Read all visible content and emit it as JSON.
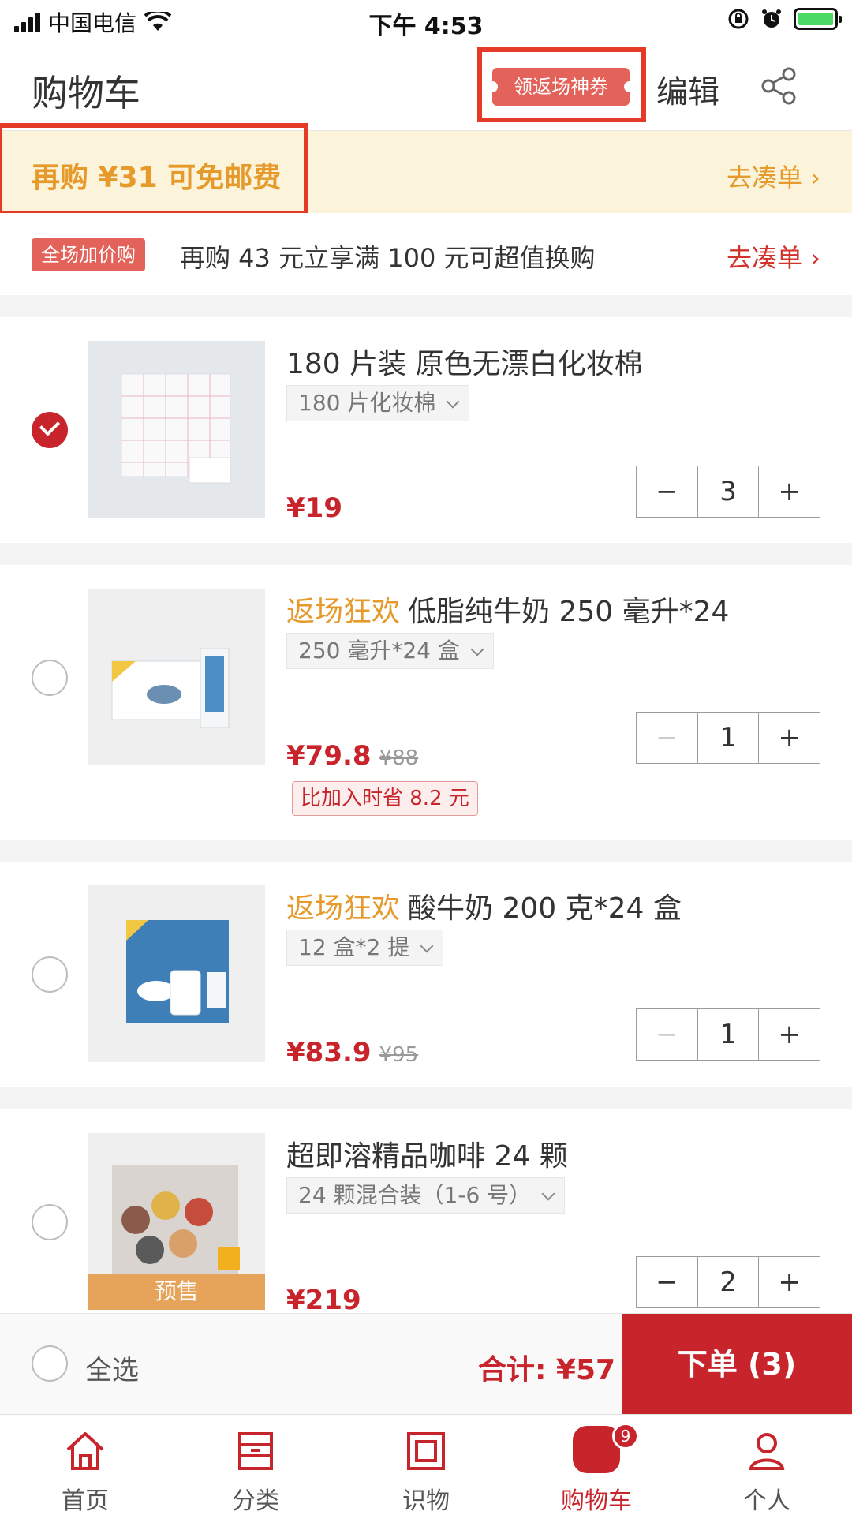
{
  "status_bar": {
    "carrier": "中国电信",
    "time": "下午 4:53"
  },
  "header": {
    "title": "购物车",
    "coupon_button": "领返场神券",
    "edit_button": "编辑",
    "share_icon": "share-icon"
  },
  "shipping_banner": {
    "text": "再购 ¥31 可免邮费",
    "link": "去凑单 ›"
  },
  "promo": {
    "badge": "全场加价购",
    "text": "再购 43 元立享满 100 元可超值换购",
    "link": "去凑单 ›"
  },
  "items": [
    {
      "title": "180 片装 原色无漂白化妆棉",
      "tag": "",
      "spec": "180 片化妆棉",
      "price": "¥19",
      "original_price": "",
      "save_tag": "",
      "quantity": "3",
      "checked": true,
      "presale": ""
    },
    {
      "title": "低脂纯牛奶 250 毫升*24",
      "tag": "返场狂欢",
      "spec": "250 毫升*24 盒",
      "price": "¥79.8",
      "original_price": "¥88",
      "save_tag": "比加入时省 8.2 元",
      "quantity": "1",
      "checked": false,
      "presale": ""
    },
    {
      "title": "酸牛奶 200 克*24 盒",
      "tag": "返场狂欢",
      "spec": "12 盒*2 提",
      "price": "¥83.9",
      "original_price": "¥95",
      "save_tag": "",
      "quantity": "1",
      "checked": false,
      "presale": ""
    },
    {
      "title": "超即溶精品咖啡 24 颗",
      "tag": "",
      "spec": "24 颗混合装（1-6 号）",
      "price": "¥219",
      "original_price": "",
      "save_tag": "",
      "quantity": "2",
      "checked": false,
      "presale": "预售"
    }
  ],
  "checkout": {
    "select_all": "全选",
    "total": "合计: ¥57",
    "order_button": "下单 (3)"
  },
  "tabs": [
    {
      "label": "首页",
      "icon": "home-icon",
      "active": false
    },
    {
      "label": "分类",
      "icon": "category-icon",
      "active": false
    },
    {
      "label": "识物",
      "icon": "discover-icon",
      "active": false
    },
    {
      "label": "购物车",
      "icon": "cart-icon",
      "active": true,
      "badge": "9"
    },
    {
      "label": "个人",
      "icon": "user-icon",
      "active": false
    }
  ],
  "colors": {
    "accent": "#c8242b",
    "tag_orange": "#e69a2b",
    "banner_bg": "#fbf4da"
  }
}
